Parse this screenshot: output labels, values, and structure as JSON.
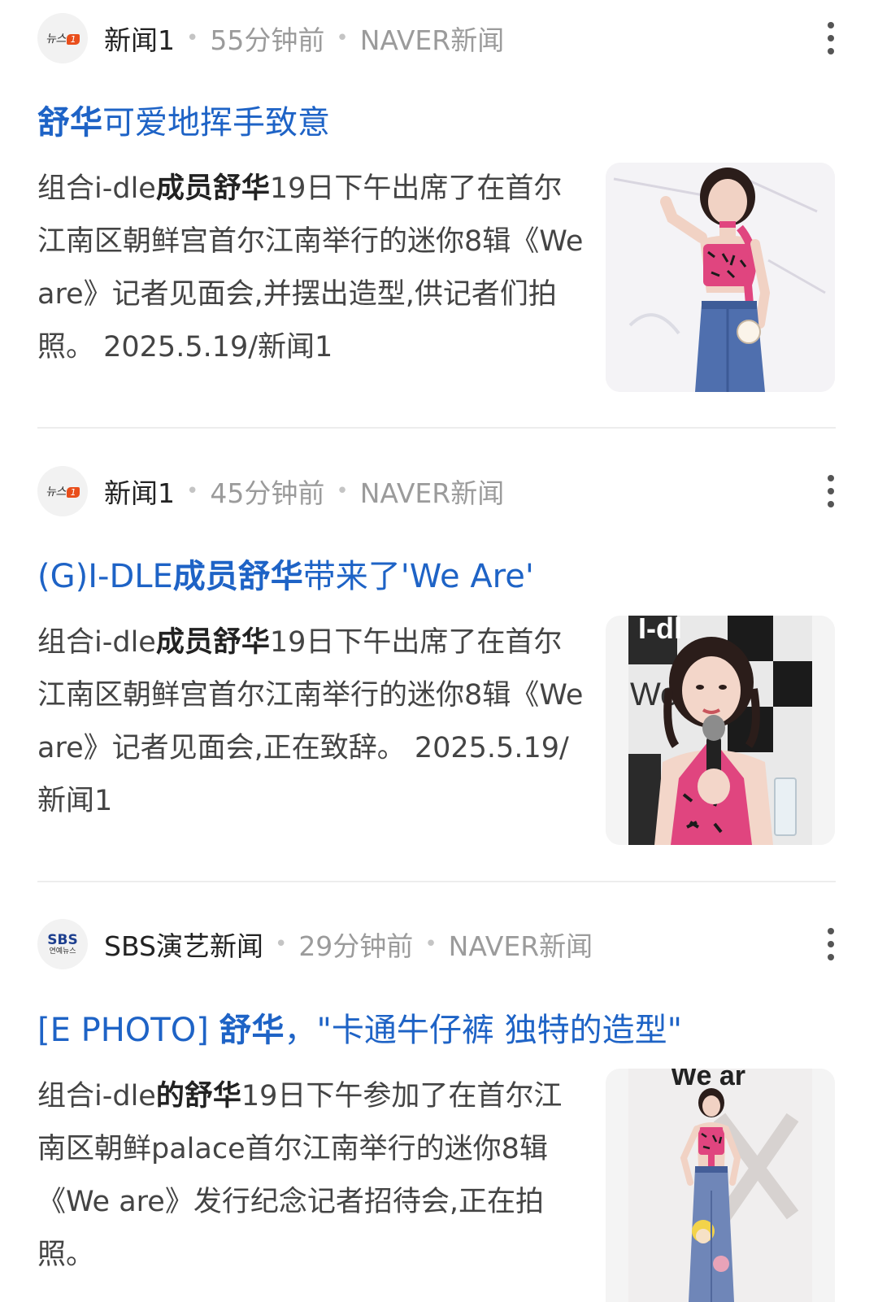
{
  "articles": [
    {
      "source": "新闻1",
      "time": "55分钟前",
      "platform": "NAVER新闻",
      "title_strong": "舒华",
      "title_rest": "可爱地挥手致意",
      "body_pre": "组合i-dle",
      "body_strong": "成员舒华",
      "body_post": "19日下午出席了在首尔江南区朝鲜宫首尔江南举行的迷你8辑《We are》记者见面会,并摆出造型,供记者们拍照。 2025.5.19/新闻1"
    },
    {
      "source": "新闻1",
      "time": "45分钟前",
      "platform": "NAVER新闻",
      "title_pre": "(G)I-DLE",
      "title_strong": "成员舒华",
      "title_rest": "带来了'We Are'",
      "body_pre": "组合i-dle",
      "body_strong": "成员舒华",
      "body_post": "19日下午出席了在首尔江南区朝鲜宫首尔江南举行的迷你8辑《We are》记者见面会,正在致辞。 2025.5.19/新闻1"
    },
    {
      "source": "SBS演艺新闻",
      "time": "29分钟前",
      "platform": "NAVER新闻",
      "title_pre": "[E PHOTO] ",
      "title_strong": "舒华",
      "title_rest": "，\"卡通牛仔裤 独特的造型\"",
      "body_pre": "组合i-dle",
      "body_strong": "的舒华",
      "body_post": "19日下午参加了在首尔江南区朝鲜palace首尔江南举行的迷你8辑《We are》发行纪念记者招待会,正在拍照。"
    }
  ],
  "logos": {
    "news1_text": "뉴스",
    "news1_badge": "1",
    "sbs_big": "SBS",
    "sbs_small": "연예뉴스"
  },
  "thumbs": {
    "thumb2_text": "I-dl",
    "thumb2_text2": "We",
    "thumb3_text": "We ar"
  },
  "colors": {
    "title_blue": "#1e63c6",
    "outfit_pink": "#e0457f",
    "denim_blue": "#4f6fae"
  }
}
